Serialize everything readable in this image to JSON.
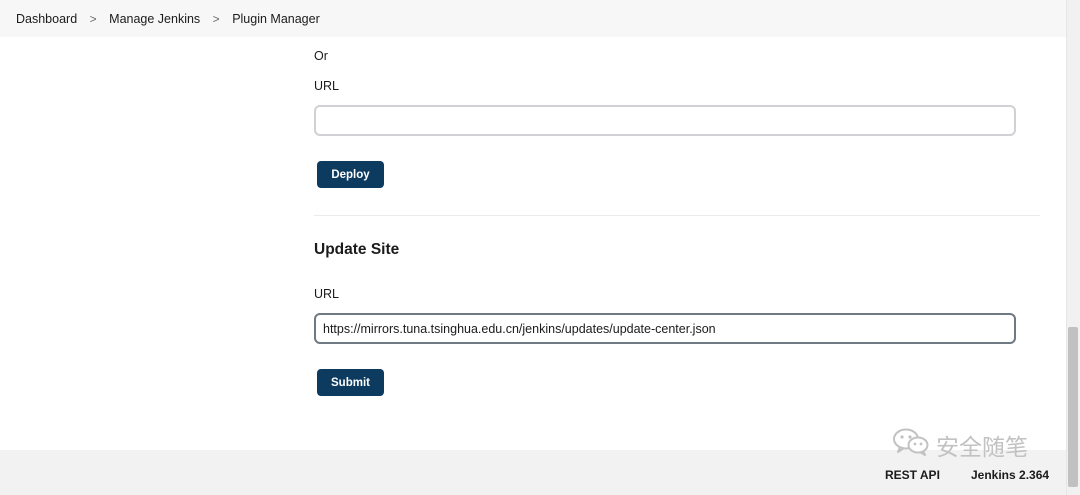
{
  "breadcrumb": {
    "items": [
      {
        "label": "Dashboard"
      },
      {
        "label": "Manage Jenkins"
      },
      {
        "label": "Plugin Manager"
      }
    ],
    "separator": ">"
  },
  "deploy_section": {
    "or_text": "Or",
    "url_label": "URL",
    "url_value": "",
    "deploy_button": "Deploy"
  },
  "update_site": {
    "title": "Update Site",
    "url_label": "URL",
    "url_value": "https://mirrors.tuna.tsinghua.edu.cn/jenkins/updates/update-center.json",
    "submit_button": "Submit"
  },
  "footer": {
    "rest_api": "REST API",
    "version": "Jenkins 2.364"
  },
  "watermark": {
    "text": "安全随笔",
    "icon": "wechat-icon"
  },
  "colors": {
    "button_bg": "#0d3a5f",
    "breadcrumb_bg": "#f7f7f8",
    "footer_bg": "#f2f2f3"
  }
}
